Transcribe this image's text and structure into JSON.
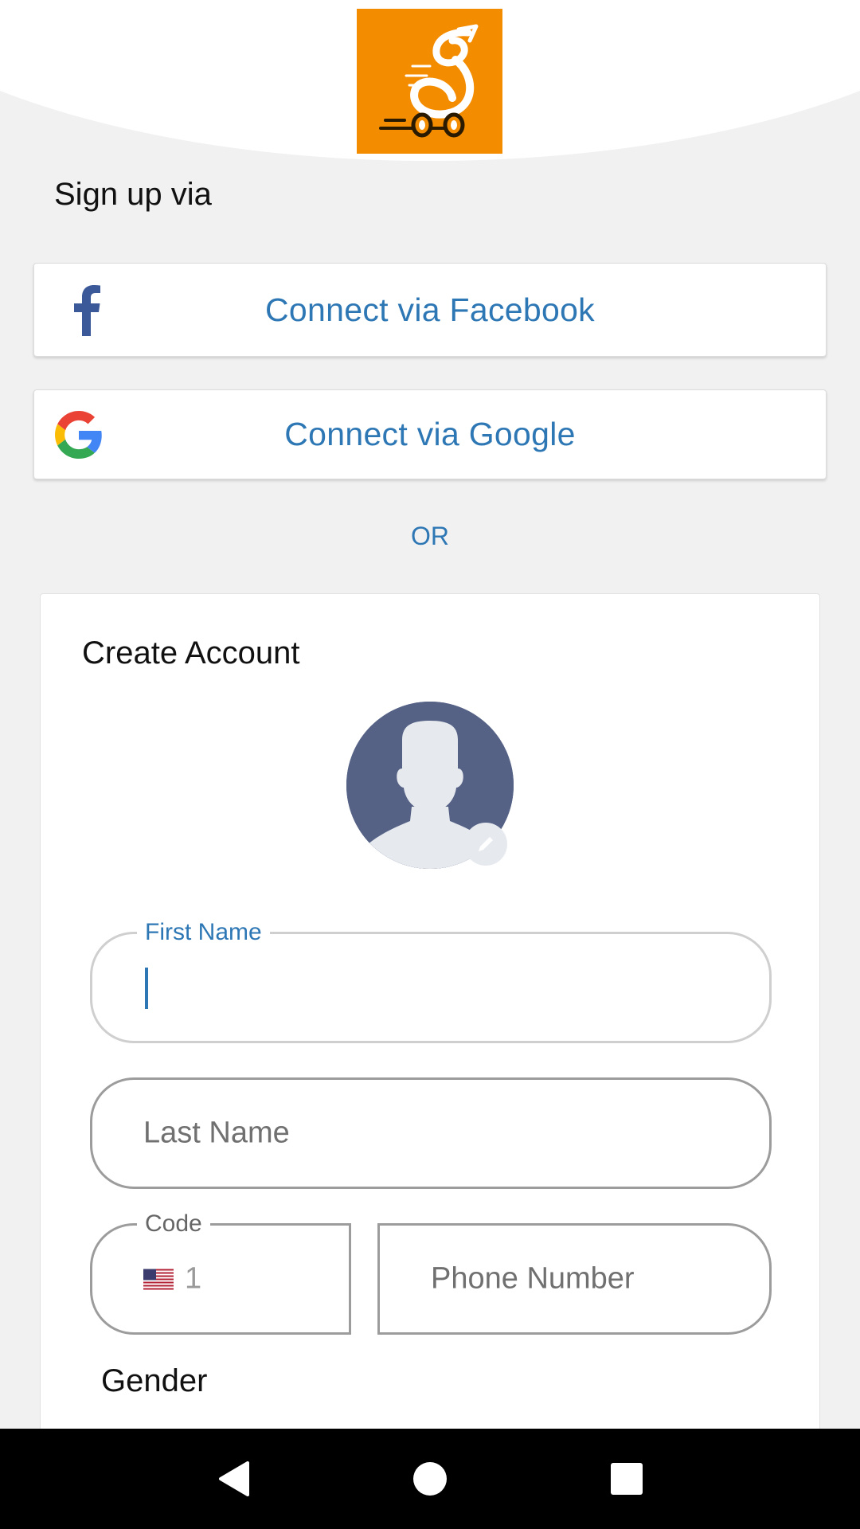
{
  "header": {
    "logo_icon": "scooter-g-logo",
    "logo_color": "#f48c00"
  },
  "signup": {
    "heading": "Sign up via",
    "facebook_label": "Connect via Facebook",
    "google_label": "Connect via Google",
    "or_text": "OR"
  },
  "account": {
    "title": "Create Account",
    "avatar_icon": "user-silhouette",
    "edit_icon": "pencil-icon",
    "first_name_label": "First Name",
    "first_name_value": "",
    "last_name_placeholder": "Last Name",
    "code_label": "Code",
    "code_value": "1",
    "code_flag": "us-flag",
    "phone_placeholder": "Phone Number",
    "gender_label": "Gender"
  },
  "colors": {
    "accent": "#2e77b5",
    "facebook": "#3b5998",
    "background": "#f1f1f1"
  },
  "navbar": {
    "back_icon": "back-triangle-icon",
    "home_icon": "home-circle-icon",
    "recents_icon": "recents-square-icon"
  }
}
